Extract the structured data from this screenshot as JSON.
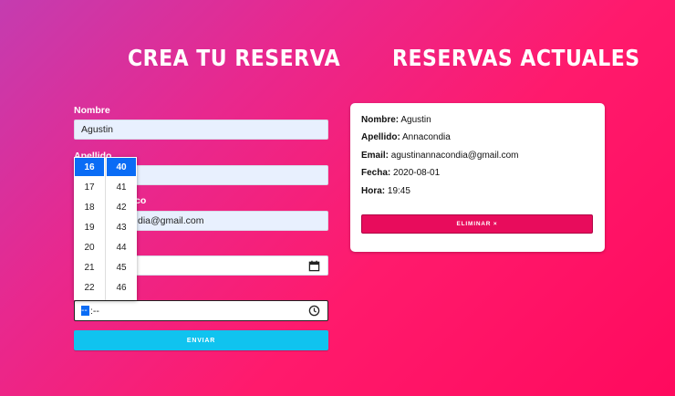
{
  "form": {
    "title": "CREA TU RESERVA",
    "nombre_label": "Nombre",
    "nombre_value": "Agustin",
    "apellido_label": "Apellido",
    "email_label_fragment": "co",
    "email_value_fragment": "dia@gmail.com",
    "time_value": "--:--",
    "time_hour_placeholder": "--",
    "time_rest": ":--",
    "send_label": "ENVIAR"
  },
  "time_picker": {
    "hours": [
      "16",
      "17",
      "18",
      "19",
      "20",
      "21",
      "22"
    ],
    "minutes": [
      "40",
      "41",
      "42",
      "43",
      "44",
      "45",
      "46"
    ],
    "selected_hour": "16",
    "selected_minute": "40"
  },
  "bookings": {
    "title": "RESERVAS ACTUALES",
    "items": [
      {
        "nombre_label": "Nombre:",
        "nombre": "Agustin",
        "apellido_label": "Apellido:",
        "apellido": "Annacondia",
        "email_label": "Email:",
        "email": "agustinannacondia@gmail.com",
        "fecha_label": "Fecha:",
        "fecha": "2020-08-01",
        "hora_label": "Hora:",
        "hora": "19:45",
        "delete_label": "ELIMINAR ×"
      }
    ]
  },
  "icons": {
    "calendar": "calendar-icon",
    "clock": "clock-icon"
  },
  "colors": {
    "send_button": "#10c3ef",
    "delete_button": "#e80c5c",
    "picker_selected": "#0a6cf5",
    "autofill_bg": "#e8f0fe"
  }
}
